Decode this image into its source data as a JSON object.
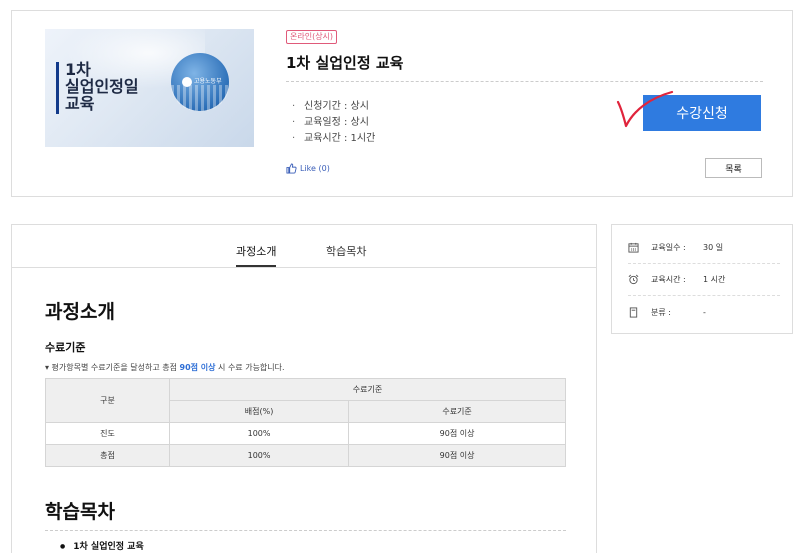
{
  "course": {
    "thumbnail": {
      "title": "1차\n실업인정일\n교육",
      "brand": "고용노동부"
    },
    "badge": "온라인(상시)",
    "title": "1차 실업인정 교육",
    "info": [
      "신청기간 : 상시",
      "교육일정 : 상시",
      "교육시간 : 1시간"
    ],
    "like_label": "Like (0)",
    "enroll_label": "수강신청",
    "list_label": "목록"
  },
  "tabs": [
    {
      "label": "과정소개"
    },
    {
      "label": "학습목차"
    }
  ],
  "intro": {
    "title": "과정소개",
    "criteria_title": "수료기준",
    "note_prefix": "▾ 평가항목별 수료기준을 달성하고 총점 ",
    "note_highlight": "90점 이상",
    "note_suffix": " 시 수료 가능합니다.",
    "table": {
      "col_group": "구분",
      "header": "수료기준",
      "sub_headers": [
        "배점(%)",
        "수료기준"
      ],
      "rows": [
        {
          "name": "진도",
          "weight": "100%",
          "criteria": "90점 이상"
        },
        {
          "name": "총점",
          "weight": "100%",
          "criteria": "90점 이상"
        }
      ]
    }
  },
  "toc": {
    "title": "학습목차",
    "items": [
      "1차 실업인정 교육"
    ]
  },
  "side": {
    "rows": [
      {
        "icon": "calendar-icon",
        "label": "교육일수 :",
        "value": "30 일"
      },
      {
        "icon": "alarm-clock-icon",
        "label": "교육시간 :",
        "value": "1 시간"
      },
      {
        "icon": "book-icon",
        "label": "분류 :",
        "value": "-"
      }
    ]
  },
  "colors": {
    "accent": "#2f7be0",
    "badge": "#e05a7a",
    "highlight": "#2f6fd6",
    "check_mark": "#e0243c"
  }
}
